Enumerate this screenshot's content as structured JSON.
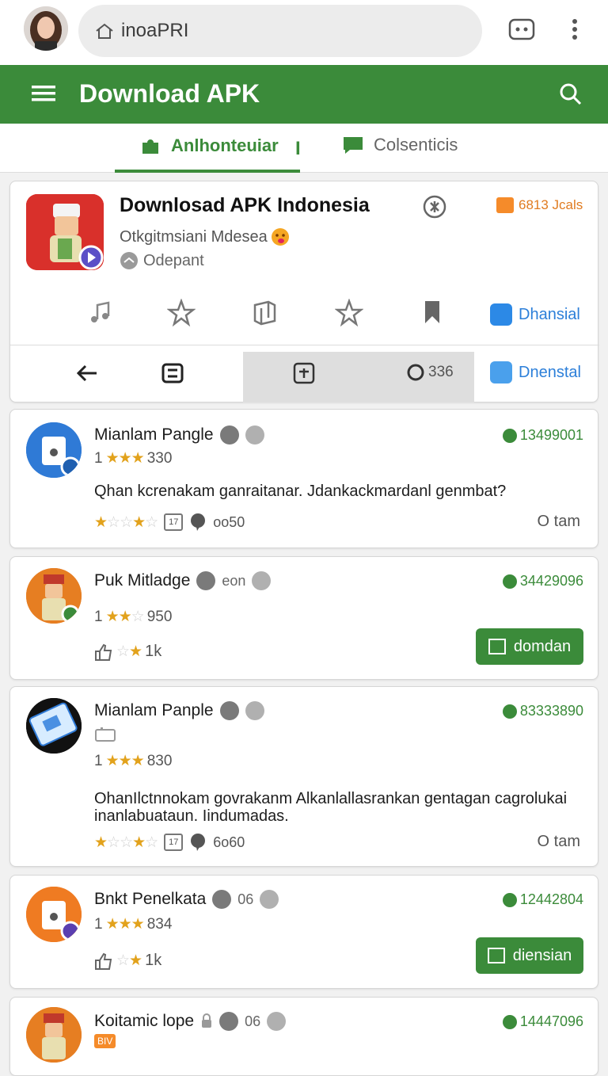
{
  "browser": {
    "address": "inoaPRI",
    "avatar_icon": "user-avatar",
    "tab_switcher_icon": "tabs-icon",
    "more_icon": "more-vertical-icon"
  },
  "appbar": {
    "title": "Download APK",
    "menu_icon": "menu-icon",
    "search_icon": "search-icon",
    "color": "#3b8b3a"
  },
  "tabs": [
    {
      "label": "Anlhonteuiar",
      "active": true
    },
    {
      "label": "Colsenticis",
      "active": false
    }
  ],
  "tab_separator": "I",
  "hero": {
    "title": "Downlosad APK Indonesia",
    "subtitle": "Otkgitmsiani Mdesea",
    "developer": "Odepant",
    "badge": "6813 Jcals",
    "action1": "Dhansial",
    "action2": "Dnenstal",
    "toolbar_count": "336",
    "icons": [
      "music-icon",
      "star-outline-icon",
      "book-icon",
      "star-outline-icon",
      "bookmark-icon"
    ],
    "toolbar_icons": [
      "back-arrow-icon",
      "switch-icon",
      "plus-box-icon",
      "loading-icon"
    ]
  },
  "items": [
    {
      "name": "Mianlam Pangle",
      "extra": "",
      "rating_prefix": "1",
      "rating_stars": 3,
      "rating_count": "330",
      "count": "13499001",
      "desc": "Qhan kcrenakam ganraitanar. Jdankackmardanl genmbat?",
      "meta_cal": "17",
      "meta_comments": "oo50",
      "time": "O tam",
      "avatar_color": "#2f7ad6"
    },
    {
      "name": "Puk Mitladge",
      "extra": "eon",
      "rating_prefix": "1",
      "rating_stars": 2,
      "rating_count": "950",
      "count": "34429096",
      "thumb_label": "1k",
      "button": "domdan",
      "avatar_color": "#e67e22"
    },
    {
      "name": "Mianlam Panple",
      "extra": "",
      "rating_prefix": "1",
      "rating_stars": 3,
      "rating_count": "830",
      "count": "83333890",
      "desc": "OhanIlctnnokam govrakanm Alkanlallasrankan gentagan cagrolukai inanlabuataun. Iindumadas.",
      "meta_cal": "17",
      "meta_comments": "6o60",
      "time": "O tam",
      "avatar_color": "#111111"
    },
    {
      "name": "Bnkt Penelkata",
      "extra": "06",
      "rating_prefix": "1",
      "rating_stars": 3,
      "rating_count": "834",
      "count": "12442804",
      "thumb_label": "1k",
      "button": "diensian",
      "avatar_color": "#ef7b22"
    },
    {
      "name": "Koitamic lope",
      "extra": "06",
      "tag": "BIV",
      "count": "14447096",
      "avatar_color": "#e67e22"
    }
  ]
}
